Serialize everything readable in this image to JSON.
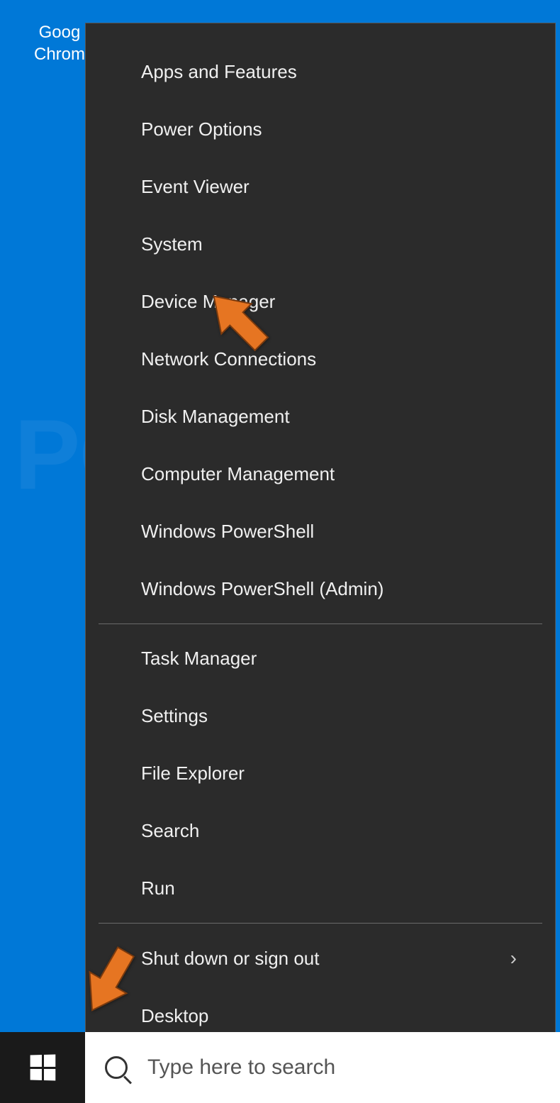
{
  "desktop": {
    "icon_label_line1": "Goog",
    "icon_label_line2": "Chrom"
  },
  "menu": {
    "group1": [
      "Apps and Features",
      "Power Options",
      "Event Viewer",
      "System",
      "Device Manager",
      "Network Connections",
      "Disk Management",
      "Computer Management",
      "Windows PowerShell",
      "Windows PowerShell (Admin)"
    ],
    "group2": [
      "Task Manager",
      "Settings",
      "File Explorer",
      "Search",
      "Run"
    ],
    "group3": [
      {
        "label": "Shut down or sign out",
        "submenu": true
      },
      {
        "label": "Desktop",
        "submenu": false
      }
    ]
  },
  "taskbar": {
    "search_placeholder": "Type here to search"
  }
}
